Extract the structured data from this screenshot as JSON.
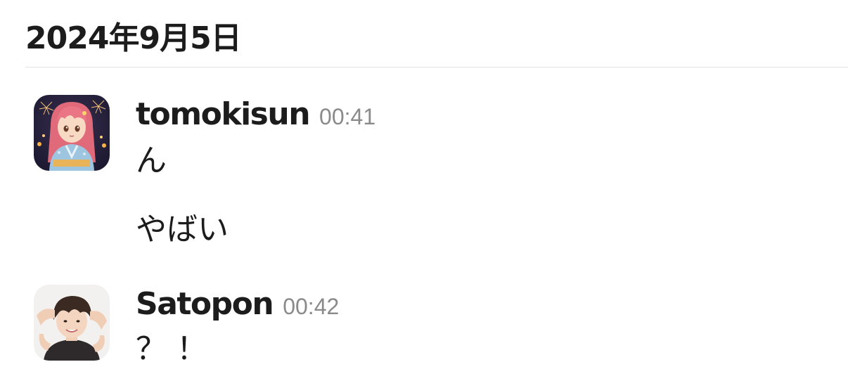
{
  "date_header": "2024年9月5日",
  "messages": [
    {
      "sender": "tomokisun",
      "time": "00:41",
      "lines": [
        "ん",
        "やばい"
      ],
      "avatar": "anime-girl-avatar"
    },
    {
      "sender": "Satopon",
      "time": "00:42",
      "lines": [
        "？！"
      ],
      "avatar": "person-photo-avatar"
    }
  ],
  "colors": {
    "text": "#1d1c1d",
    "timestamp": "#8a8a8a",
    "divider": "#e2e2e2"
  }
}
